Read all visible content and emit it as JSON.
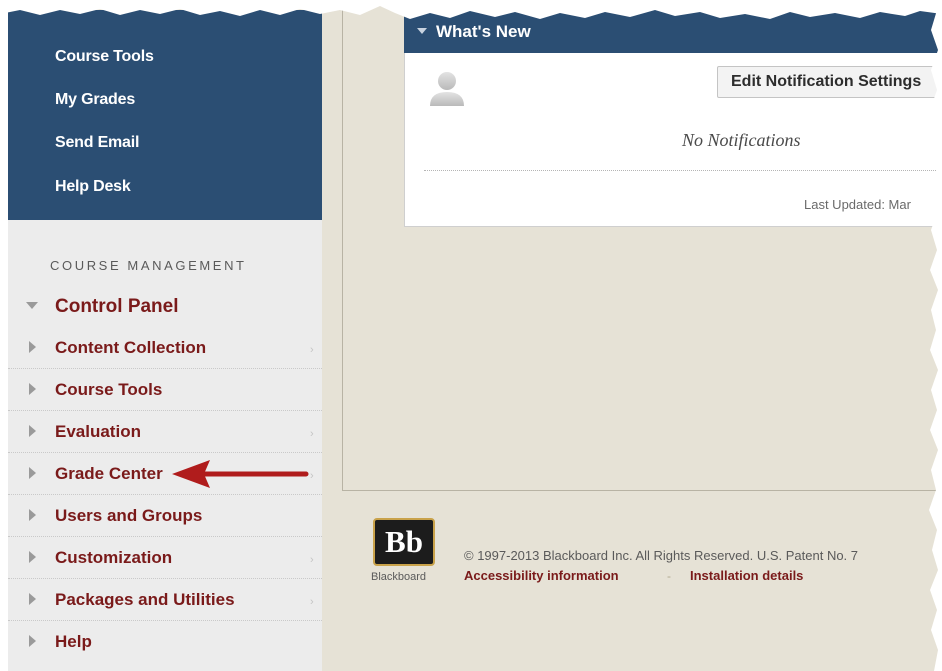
{
  "left_menu": {
    "items": [
      {
        "label": "Course Tools"
      },
      {
        "label": "My Grades"
      },
      {
        "label": "Send Email"
      },
      {
        "label": "Help Desk"
      }
    ]
  },
  "course_management": {
    "heading": "COURSE MANAGEMENT",
    "control_panel_label": "Control Panel",
    "items": [
      {
        "label": "Content Collection"
      },
      {
        "label": "Course Tools"
      },
      {
        "label": "Evaluation"
      },
      {
        "label": "Grade Center"
      },
      {
        "label": "Users and Groups"
      },
      {
        "label": "Customization"
      },
      {
        "label": "Packages and Utilities"
      },
      {
        "label": "Help"
      }
    ]
  },
  "whats_new": {
    "title": "What's New",
    "edit_button_label": "Edit Notification Settings",
    "empty_message": "No Notifications",
    "last_updated": "Last Updated: Mar"
  },
  "footer": {
    "logo_text": "Bb",
    "logo_word": "Blackboard",
    "copyright": "© 1997-2013 Blackboard Inc. All Rights Reserved. U.S. Patent No. 7",
    "links": [
      {
        "label": "Accessibility information"
      },
      {
        "label": "Installation details"
      }
    ],
    "separator": "-"
  },
  "colors": {
    "navy": "#2b4e73",
    "maroon": "#7a1a1a",
    "beige": "#e6e2d6",
    "annotation_arrow": "#b01c1c"
  },
  "icons": {
    "avatar": "user-silhouette-icon",
    "collapse": "triangle-down-icon",
    "expand": "triangle-right-icon",
    "submenu": "chevron-right-icon",
    "annotation": "arrow-left-icon"
  }
}
